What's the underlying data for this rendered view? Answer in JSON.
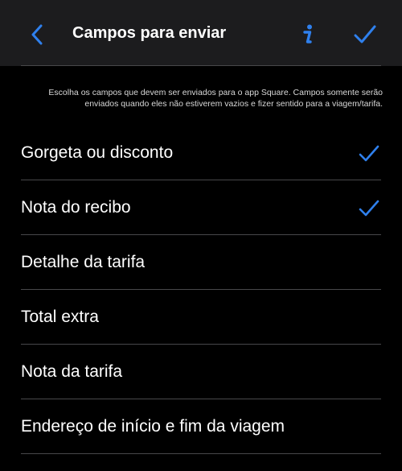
{
  "nav": {
    "title": "Campos para enviar",
    "back_icon": "chevron-left-icon",
    "info_icon": "info-icon",
    "done_icon": "checkmark-icon"
  },
  "description": "Escolha os campos que devem ser enviados para o app Square. Campos somente serão enviados quando eles não estiverem vazios e fizer sentido para a viagem/tarifa.",
  "fields": [
    {
      "label": "Gorgeta ou disconto",
      "selected": true
    },
    {
      "label": "Nota do recibo",
      "selected": true
    },
    {
      "label": "Detalhe da tarifa",
      "selected": false
    },
    {
      "label": "Total extra",
      "selected": false
    },
    {
      "label": "Nota da tarifa",
      "selected": false
    },
    {
      "label": "Endereço de início e fim da viagem",
      "selected": false
    }
  ],
  "colors": {
    "accent": "#2f80ed",
    "background": "#000000",
    "nav_background": "#1c1c1e",
    "separator": "#48484a",
    "text": "#ffffff"
  }
}
